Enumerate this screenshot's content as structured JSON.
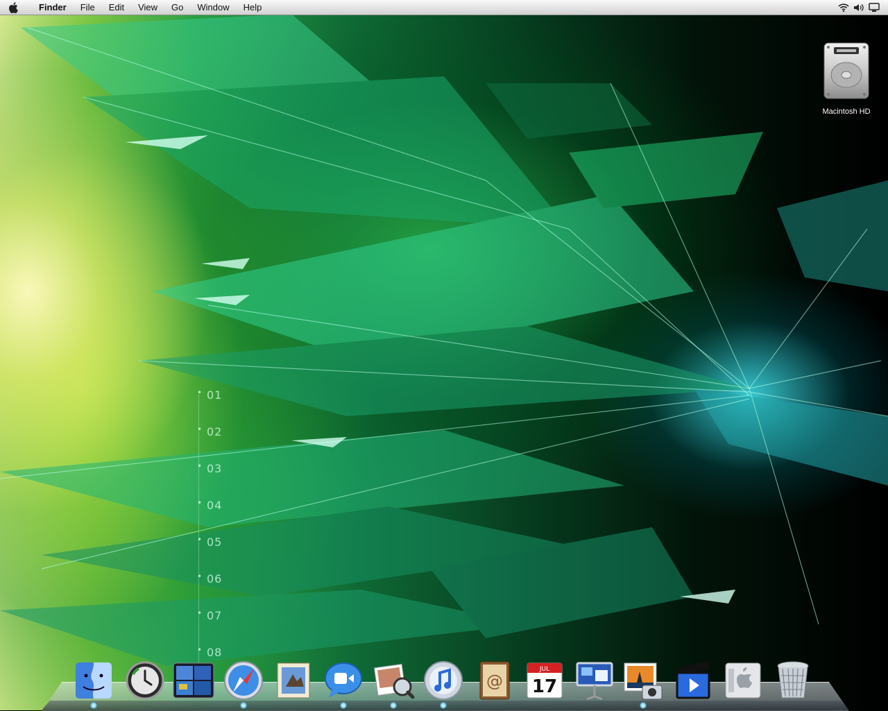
{
  "menubar": {
    "app_name": "Finder",
    "menus": [
      "File",
      "Edit",
      "View",
      "Go",
      "Window",
      "Help"
    ],
    "status_icons": [
      "wifi-icon",
      "volume-icon",
      "display-icon"
    ]
  },
  "desktop": {
    "icons": [
      {
        "label": "Macintosh HD",
        "icon": "hard-drive-icon"
      }
    ],
    "wallpaper_ticks": [
      "01",
      "02",
      "03",
      "04",
      "05",
      "06",
      "07",
      "08"
    ]
  },
  "dock": {
    "items": [
      {
        "name": "finder",
        "icon": "finder-icon",
        "running": true
      },
      {
        "name": "time-machine",
        "icon": "time-machine-icon",
        "running": false
      },
      {
        "name": "spaces",
        "icon": "spaces-icon",
        "running": false
      },
      {
        "name": "safari",
        "icon": "safari-icon",
        "running": true
      },
      {
        "name": "mail",
        "icon": "mail-icon",
        "running": false
      },
      {
        "name": "ichat",
        "icon": "ichat-icon",
        "running": true
      },
      {
        "name": "preview",
        "icon": "preview-icon",
        "running": true
      },
      {
        "name": "itunes",
        "icon": "itunes-icon",
        "running": true
      },
      {
        "name": "address-book",
        "icon": "address-book-icon",
        "running": false
      },
      {
        "name": "ical",
        "icon": "ical-icon",
        "running": false,
        "date_month": "JUL",
        "date_day": "17"
      },
      {
        "name": "keynote",
        "icon": "keynote-icon",
        "running": false
      },
      {
        "name": "iphoto",
        "icon": "iphoto-icon",
        "running": true
      },
      {
        "name": "imovie",
        "icon": "imovie-icon",
        "running": false
      },
      {
        "name": "system-preferences",
        "icon": "system-preferences-icon",
        "running": false
      },
      {
        "name": "trash",
        "icon": "trash-icon",
        "running": false
      }
    ]
  }
}
